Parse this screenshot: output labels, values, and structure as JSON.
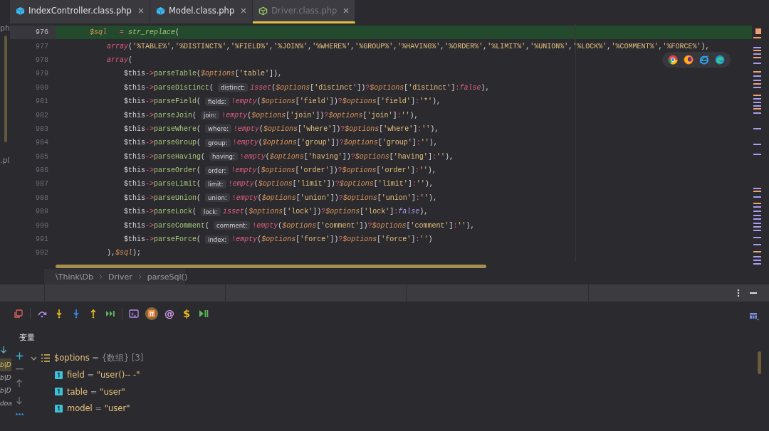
{
  "tabs": [
    {
      "label": "IndexController.class.php",
      "kind": "filled",
      "selected": false,
      "dimmed": false
    },
    {
      "label": "Model.class.php",
      "kind": "filled",
      "selected": false,
      "dimmed": false
    },
    {
      "label": "Driver.class.php",
      "kind": "outline",
      "selected": true,
      "dimmed": true
    }
  ],
  "project_fragments": [
    "ph",
    ".pl"
  ],
  "editor": {
    "lines": [
      {
        "number": "976",
        "current": true,
        "tokens": [
          {
            "kind": "var",
            "text": "$sql"
          },
          {
            "kind": "op",
            "text": "   = "
          },
          {
            "kind": "fnc",
            "text": "str_replace"
          },
          {
            "kind": "plain",
            "text": "("
          }
        ],
        "children": [
          {
            "number": "977",
            "current": false,
            "tokens": [
              {
                "kind": "kw",
                "text": "array"
              },
              {
                "kind": "plain",
                "text": "("
              },
              {
                "kind": "str",
                "text": "'%TABLE%'"
              },
              {
                "kind": "plain",
                "text": ","
              },
              {
                "kind": "str",
                "text": "'%DISTINCT%'"
              },
              {
                "kind": "plain",
                "text": ","
              },
              {
                "kind": "str",
                "text": "'%FIELD%'"
              },
              {
                "kind": "plain",
                "text": ","
              },
              {
                "kind": "str",
                "text": "'%JOIN%'"
              },
              {
                "kind": "plain",
                "text": ","
              },
              {
                "kind": "str",
                "text": "'%WHERE%'"
              },
              {
                "kind": "plain",
                "text": ","
              },
              {
                "kind": "str",
                "text": "'%GROUP%'"
              },
              {
                "kind": "plain",
                "text": ","
              },
              {
                "kind": "str",
                "text": "'%HAVING%'"
              },
              {
                "kind": "plain",
                "text": ","
              },
              {
                "kind": "str",
                "text": "'%ORDER%'"
              },
              {
                "kind": "plain",
                "text": ","
              },
              {
                "kind": "str",
                "text": "'%LIMIT%'"
              },
              {
                "kind": "plain",
                "text": ","
              },
              {
                "kind": "str",
                "text": "'%UNION%'"
              },
              {
                "kind": "plain",
                "text": ","
              },
              {
                "kind": "str",
                "text": "'%LOCK%'"
              },
              {
                "kind": "plain",
                "text": ","
              },
              {
                "kind": "str",
                "text": "'%COMMENT%'"
              },
              {
                "kind": "plain",
                "text": ","
              },
              {
                "kind": "str",
                "text": "'%FORCE%'"
              },
              {
                "kind": "plain",
                "text": "),"
              }
            ]
          },
          {
            "number": "978",
            "current": false,
            "tokens": [
              {
                "kind": "kw",
                "text": "array"
              },
              {
                "kind": "plain",
                "text": "("
              }
            ],
            "children": [
              {
                "number": "979",
                "current": false,
                "tokens": [
                  {
                    "kind": "plain",
                    "text": "$this"
                  },
                  {
                    "kind": "op",
                    "text": "->"
                  },
                  {
                    "kind": "fn",
                    "text": "parseTable"
                  },
                  {
                    "kind": "plain",
                    "text": "("
                  },
                  {
                    "kind": "var",
                    "text": "$options"
                  },
                  {
                    "kind": "plain",
                    "text": "["
                  },
                  {
                    "kind": "str",
                    "text": "'table'"
                  },
                  {
                    "kind": "plain",
                    "text": "]),"
                  }
                ]
              },
              {
                "number": "980",
                "current": false,
                "tokens": [
                  {
                    "kind": "plain",
                    "text": "$this"
                  },
                  {
                    "kind": "op",
                    "text": "->"
                  },
                  {
                    "kind": "fn",
                    "text": "parseDistinct"
                  },
                  {
                    "kind": "plain",
                    "text": "( "
                  },
                  {
                    "kind": "hint",
                    "text": "distinct:"
                  },
                  {
                    "kind": "kw",
                    "text": "isset"
                  },
                  {
                    "kind": "plain",
                    "text": "("
                  },
                  {
                    "kind": "var",
                    "text": "$options"
                  },
                  {
                    "kind": "plain",
                    "text": "["
                  },
                  {
                    "kind": "str",
                    "text": "'distinct'"
                  },
                  {
                    "kind": "plain",
                    "text": "])"
                  },
                  {
                    "kind": "op",
                    "text": "?"
                  },
                  {
                    "kind": "var",
                    "text": "$options"
                  },
                  {
                    "kind": "plain",
                    "text": "["
                  },
                  {
                    "kind": "str",
                    "text": "'distinct'"
                  },
                  {
                    "kind": "plain",
                    "text": "]"
                  },
                  {
                    "kind": "op",
                    "text": ":"
                  },
                  {
                    "kind": "kw",
                    "text": "false"
                  },
                  {
                    "kind": "plain",
                    "text": "),"
                  }
                ]
              },
              {
                "number": "981",
                "current": false,
                "tokens": [
                  {
                    "kind": "plain",
                    "text": "$this"
                  },
                  {
                    "kind": "op",
                    "text": "->"
                  },
                  {
                    "kind": "fn",
                    "text": "parseField"
                  },
                  {
                    "kind": "plain",
                    "text": "( "
                  },
                  {
                    "kind": "hint",
                    "text": "fields:"
                  },
                  {
                    "kind": "op",
                    "text": "!"
                  },
                  {
                    "kind": "kw",
                    "text": "empty"
                  },
                  {
                    "kind": "plain",
                    "text": "("
                  },
                  {
                    "kind": "var",
                    "text": "$options"
                  },
                  {
                    "kind": "plain",
                    "text": "["
                  },
                  {
                    "kind": "str",
                    "text": "'field'"
                  },
                  {
                    "kind": "plain",
                    "text": "])"
                  },
                  {
                    "kind": "op",
                    "text": "?"
                  },
                  {
                    "kind": "var",
                    "text": "$options"
                  },
                  {
                    "kind": "plain",
                    "text": "["
                  },
                  {
                    "kind": "str",
                    "text": "'field'"
                  },
                  {
                    "kind": "plain",
                    "text": "]"
                  },
                  {
                    "kind": "op",
                    "text": ":"
                  },
                  {
                    "kind": "str",
                    "text": "'*'"
                  },
                  {
                    "kind": "plain",
                    "text": "),"
                  }
                ]
              },
              {
                "number": "982",
                "current": false,
                "tokens": [
                  {
                    "kind": "plain",
                    "text": "$this"
                  },
                  {
                    "kind": "op",
                    "text": "->"
                  },
                  {
                    "kind": "fn",
                    "text": "parseJoin"
                  },
                  {
                    "kind": "plain",
                    "text": "( "
                  },
                  {
                    "kind": "hint",
                    "text": "join:"
                  },
                  {
                    "kind": "op",
                    "text": "!"
                  },
                  {
                    "kind": "kw",
                    "text": "empty"
                  },
                  {
                    "kind": "plain",
                    "text": "("
                  },
                  {
                    "kind": "var",
                    "text": "$options"
                  },
                  {
                    "kind": "plain",
                    "text": "["
                  },
                  {
                    "kind": "str",
                    "text": "'join'"
                  },
                  {
                    "kind": "plain",
                    "text": "])"
                  },
                  {
                    "kind": "op",
                    "text": "?"
                  },
                  {
                    "kind": "var",
                    "text": "$options"
                  },
                  {
                    "kind": "plain",
                    "text": "["
                  },
                  {
                    "kind": "str",
                    "text": "'join'"
                  },
                  {
                    "kind": "plain",
                    "text": "]"
                  },
                  {
                    "kind": "op",
                    "text": ":"
                  },
                  {
                    "kind": "str",
                    "text": "''"
                  },
                  {
                    "kind": "plain",
                    "text": "),"
                  }
                ]
              },
              {
                "number": "983",
                "current": false,
                "tokens": [
                  {
                    "kind": "plain",
                    "text": "$this"
                  },
                  {
                    "kind": "op",
                    "text": "->"
                  },
                  {
                    "kind": "fn",
                    "text": "parseWhere"
                  },
                  {
                    "kind": "plain",
                    "text": "( "
                  },
                  {
                    "kind": "hint",
                    "text": "where:"
                  },
                  {
                    "kind": "op",
                    "text": "!"
                  },
                  {
                    "kind": "kw",
                    "text": "empty"
                  },
                  {
                    "kind": "plain",
                    "text": "("
                  },
                  {
                    "kind": "var",
                    "text": "$options"
                  },
                  {
                    "kind": "plain",
                    "text": "["
                  },
                  {
                    "kind": "str",
                    "text": "'where'"
                  },
                  {
                    "kind": "plain",
                    "text": "])"
                  },
                  {
                    "kind": "op",
                    "text": "?"
                  },
                  {
                    "kind": "var",
                    "text": "$options"
                  },
                  {
                    "kind": "plain",
                    "text": "["
                  },
                  {
                    "kind": "str",
                    "text": "'where'"
                  },
                  {
                    "kind": "plain",
                    "text": "]"
                  },
                  {
                    "kind": "op",
                    "text": ":"
                  },
                  {
                    "kind": "str",
                    "text": "''"
                  },
                  {
                    "kind": "plain",
                    "text": "),"
                  }
                ]
              },
              {
                "number": "984",
                "current": false,
                "tokens": [
                  {
                    "kind": "plain",
                    "text": "$this"
                  },
                  {
                    "kind": "op",
                    "text": "->"
                  },
                  {
                    "kind": "fn",
                    "text": "parseGroup"
                  },
                  {
                    "kind": "plain",
                    "text": "( "
                  },
                  {
                    "kind": "hint",
                    "text": "group:"
                  },
                  {
                    "kind": "op",
                    "text": "!"
                  },
                  {
                    "kind": "kw",
                    "text": "empty"
                  },
                  {
                    "kind": "plain",
                    "text": "("
                  },
                  {
                    "kind": "var",
                    "text": "$options"
                  },
                  {
                    "kind": "plain",
                    "text": "["
                  },
                  {
                    "kind": "str",
                    "text": "'group'"
                  },
                  {
                    "kind": "plain",
                    "text": "])"
                  },
                  {
                    "kind": "op",
                    "text": "?"
                  },
                  {
                    "kind": "var",
                    "text": "$options"
                  },
                  {
                    "kind": "plain",
                    "text": "["
                  },
                  {
                    "kind": "str",
                    "text": "'group'"
                  },
                  {
                    "kind": "plain",
                    "text": "]"
                  },
                  {
                    "kind": "op",
                    "text": ":"
                  },
                  {
                    "kind": "str",
                    "text": "''"
                  },
                  {
                    "kind": "plain",
                    "text": "),"
                  }
                ]
              },
              {
                "number": "985",
                "current": false,
                "tokens": [
                  {
                    "kind": "plain",
                    "text": "$this"
                  },
                  {
                    "kind": "op",
                    "text": "->"
                  },
                  {
                    "kind": "fn",
                    "text": "parseHaving"
                  },
                  {
                    "kind": "plain",
                    "text": "( "
                  },
                  {
                    "kind": "hint",
                    "text": "having:"
                  },
                  {
                    "kind": "op",
                    "text": "!"
                  },
                  {
                    "kind": "kw",
                    "text": "empty"
                  },
                  {
                    "kind": "plain",
                    "text": "("
                  },
                  {
                    "kind": "var",
                    "text": "$options"
                  },
                  {
                    "kind": "plain",
                    "text": "["
                  },
                  {
                    "kind": "str",
                    "text": "'having'"
                  },
                  {
                    "kind": "plain",
                    "text": "])"
                  },
                  {
                    "kind": "op",
                    "text": "?"
                  },
                  {
                    "kind": "var",
                    "text": "$options"
                  },
                  {
                    "kind": "plain",
                    "text": "["
                  },
                  {
                    "kind": "str",
                    "text": "'having'"
                  },
                  {
                    "kind": "plain",
                    "text": "]"
                  },
                  {
                    "kind": "op",
                    "text": ":"
                  },
                  {
                    "kind": "str",
                    "text": "''"
                  },
                  {
                    "kind": "plain",
                    "text": "),"
                  }
                ]
              },
              {
                "number": "986",
                "current": false,
                "tokens": [
                  {
                    "kind": "plain",
                    "text": "$this"
                  },
                  {
                    "kind": "op",
                    "text": "->"
                  },
                  {
                    "kind": "fn",
                    "text": "parseOrder"
                  },
                  {
                    "kind": "plain",
                    "text": "( "
                  },
                  {
                    "kind": "hint",
                    "text": "order:"
                  },
                  {
                    "kind": "op",
                    "text": "!"
                  },
                  {
                    "kind": "kw",
                    "text": "empty"
                  },
                  {
                    "kind": "plain",
                    "text": "("
                  },
                  {
                    "kind": "var",
                    "text": "$options"
                  },
                  {
                    "kind": "plain",
                    "text": "["
                  },
                  {
                    "kind": "str",
                    "text": "'order'"
                  },
                  {
                    "kind": "plain",
                    "text": "])"
                  },
                  {
                    "kind": "op",
                    "text": "?"
                  },
                  {
                    "kind": "var",
                    "text": "$options"
                  },
                  {
                    "kind": "plain",
                    "text": "["
                  },
                  {
                    "kind": "str",
                    "text": "'order'"
                  },
                  {
                    "kind": "plain",
                    "text": "]"
                  },
                  {
                    "kind": "op",
                    "text": ":"
                  },
                  {
                    "kind": "str",
                    "text": "''"
                  },
                  {
                    "kind": "plain",
                    "text": "),"
                  }
                ]
              },
              {
                "number": "987",
                "current": false,
                "tokens": [
                  {
                    "kind": "plain",
                    "text": "$this"
                  },
                  {
                    "kind": "op",
                    "text": "->"
                  },
                  {
                    "kind": "fn",
                    "text": "parseLimit"
                  },
                  {
                    "kind": "plain",
                    "text": "( "
                  },
                  {
                    "kind": "hint",
                    "text": "limit:"
                  },
                  {
                    "kind": "op",
                    "text": "!"
                  },
                  {
                    "kind": "kw",
                    "text": "empty"
                  },
                  {
                    "kind": "plain",
                    "text": "("
                  },
                  {
                    "kind": "var",
                    "text": "$options"
                  },
                  {
                    "kind": "plain",
                    "text": "["
                  },
                  {
                    "kind": "str",
                    "text": "'limit'"
                  },
                  {
                    "kind": "plain",
                    "text": "])"
                  },
                  {
                    "kind": "op",
                    "text": "?"
                  },
                  {
                    "kind": "var",
                    "text": "$options"
                  },
                  {
                    "kind": "plain",
                    "text": "["
                  },
                  {
                    "kind": "str",
                    "text": "'limit'"
                  },
                  {
                    "kind": "plain",
                    "text": "]"
                  },
                  {
                    "kind": "op",
                    "text": ":"
                  },
                  {
                    "kind": "str",
                    "text": "''"
                  },
                  {
                    "kind": "plain",
                    "text": "),"
                  }
                ]
              },
              {
                "number": "988",
                "current": false,
                "tokens": [
                  {
                    "kind": "plain",
                    "text": "$this"
                  },
                  {
                    "kind": "op",
                    "text": "->"
                  },
                  {
                    "kind": "fn",
                    "text": "parseUnion"
                  },
                  {
                    "kind": "plain",
                    "text": "( "
                  },
                  {
                    "kind": "hint",
                    "text": "union:"
                  },
                  {
                    "kind": "op",
                    "text": "!"
                  },
                  {
                    "kind": "kw",
                    "text": "empty"
                  },
                  {
                    "kind": "plain",
                    "text": "("
                  },
                  {
                    "kind": "var",
                    "text": "$options"
                  },
                  {
                    "kind": "plain",
                    "text": "["
                  },
                  {
                    "kind": "str",
                    "text": "'union'"
                  },
                  {
                    "kind": "plain",
                    "text": "])"
                  },
                  {
                    "kind": "op",
                    "text": "?"
                  },
                  {
                    "kind": "var",
                    "text": "$options"
                  },
                  {
                    "kind": "plain",
                    "text": "["
                  },
                  {
                    "kind": "str",
                    "text": "'union'"
                  },
                  {
                    "kind": "plain",
                    "text": "]"
                  },
                  {
                    "kind": "op",
                    "text": ":"
                  },
                  {
                    "kind": "str",
                    "text": "''"
                  },
                  {
                    "kind": "plain",
                    "text": "),"
                  }
                ]
              },
              {
                "number": "989",
                "current": false,
                "tokens": [
                  {
                    "kind": "plain",
                    "text": "$this"
                  },
                  {
                    "kind": "op",
                    "text": "->"
                  },
                  {
                    "kind": "fn",
                    "text": "parseLock"
                  },
                  {
                    "kind": "plain",
                    "text": "( "
                  },
                  {
                    "kind": "hint",
                    "text": "lock:"
                  },
                  {
                    "kind": "kw",
                    "text": "isset"
                  },
                  {
                    "kind": "plain",
                    "text": "("
                  },
                  {
                    "kind": "var",
                    "text": "$options"
                  },
                  {
                    "kind": "plain",
                    "text": "["
                  },
                  {
                    "kind": "str",
                    "text": "'lock'"
                  },
                  {
                    "kind": "plain",
                    "text": "])"
                  },
                  {
                    "kind": "op",
                    "text": "?"
                  },
                  {
                    "kind": "var",
                    "text": "$options"
                  },
                  {
                    "kind": "plain",
                    "text": "["
                  },
                  {
                    "kind": "str",
                    "text": "'lock'"
                  },
                  {
                    "kind": "plain",
                    "text": "]"
                  },
                  {
                    "kind": "op",
                    "text": ":"
                  },
                  {
                    "kind": "bool",
                    "text": "false"
                  },
                  {
                    "kind": "plain",
                    "text": "),"
                  }
                ]
              },
              {
                "number": "990",
                "current": false,
                "tokens": [
                  {
                    "kind": "plain",
                    "text": "$this"
                  },
                  {
                    "kind": "op",
                    "text": "->"
                  },
                  {
                    "kind": "fn",
                    "text": "parseComment"
                  },
                  {
                    "kind": "plain",
                    "text": "( "
                  },
                  {
                    "kind": "hint",
                    "text": "comment:"
                  },
                  {
                    "kind": "op",
                    "text": "!"
                  },
                  {
                    "kind": "kw",
                    "text": "empty"
                  },
                  {
                    "kind": "plain",
                    "text": "("
                  },
                  {
                    "kind": "var",
                    "text": "$options"
                  },
                  {
                    "kind": "plain",
                    "text": "["
                  },
                  {
                    "kind": "str",
                    "text": "'comment'"
                  },
                  {
                    "kind": "plain",
                    "text": "])"
                  },
                  {
                    "kind": "op",
                    "text": "?"
                  },
                  {
                    "kind": "var",
                    "text": "$options"
                  },
                  {
                    "kind": "plain",
                    "text": "["
                  },
                  {
                    "kind": "str",
                    "text": "'comment'"
                  },
                  {
                    "kind": "plain",
                    "text": "]"
                  },
                  {
                    "kind": "op",
                    "text": ":"
                  },
                  {
                    "kind": "str",
                    "text": "''"
                  },
                  {
                    "kind": "plain",
                    "text": "),"
                  }
                ]
              },
              {
                "number": "991",
                "current": false,
                "tokens": [
                  {
                    "kind": "plain",
                    "text": "$this"
                  },
                  {
                    "kind": "op",
                    "text": "->"
                  },
                  {
                    "kind": "fn",
                    "text": "parseForce"
                  },
                  {
                    "kind": "plain",
                    "text": "( "
                  },
                  {
                    "kind": "hint",
                    "text": "index:"
                  },
                  {
                    "kind": "op",
                    "text": "!"
                  },
                  {
                    "kind": "kw",
                    "text": "empty"
                  },
                  {
                    "kind": "plain",
                    "text": "("
                  },
                  {
                    "kind": "var",
                    "text": "$options"
                  },
                  {
                    "kind": "plain",
                    "text": "["
                  },
                  {
                    "kind": "str",
                    "text": "'force'"
                  },
                  {
                    "kind": "plain",
                    "text": "])"
                  },
                  {
                    "kind": "op",
                    "text": "?"
                  },
                  {
                    "kind": "var",
                    "text": "$options"
                  },
                  {
                    "kind": "plain",
                    "text": "["
                  },
                  {
                    "kind": "str",
                    "text": "'force'"
                  },
                  {
                    "kind": "plain",
                    "text": "]"
                  },
                  {
                    "kind": "op",
                    "text": ":"
                  },
                  {
                    "kind": "str",
                    "text": "''"
                  },
                  {
                    "kind": "plain",
                    "text": ")"
                  }
                ]
              }
            ]
          },
          {
            "number": "992",
            "current": false,
            "tokens": [
              {
                "kind": "plain",
                "text": "),"
              },
              {
                "kind": "var",
                "text": "$sql"
              },
              {
                "kind": "plain",
                "text": ");"
              }
            ]
          }
        ]
      }
    ]
  },
  "breadcrumbs": [
    "\\Think\\Db",
    "Driver",
    "parseSql()"
  ],
  "debug": {
    "toolbar": [
      {
        "kind": "stop",
        "on": false
      },
      {
        "kind": "step-over",
        "on": false
      },
      {
        "kind": "step-into",
        "on": false
      },
      {
        "kind": "force-step-into",
        "on": false
      },
      {
        "kind": "step-out",
        "on": false
      },
      {
        "kind": "run-to-cursor",
        "on": false
      },
      {
        "kind": "console",
        "on": false
      },
      {
        "kind": "pi",
        "on": true
      },
      {
        "kind": "glyph",
        "text": "@",
        "on": false
      },
      {
        "kind": "glyph",
        "text": "$",
        "on": false
      },
      {
        "kind": "resume",
        "on": false
      }
    ],
    "section_title": "变量",
    "frames": [
      {
        "label": "b|D",
        "selected": true
      },
      {
        "label": "b|D",
        "selected": false
      },
      {
        "label": "b|D",
        "selected": false
      },
      {
        "label": "doa",
        "selected": false
      }
    ],
    "variable": {
      "name": "$options",
      "operator": "=",
      "type": "{数组}",
      "count": "[3]",
      "expanded": true,
      "children": [
        {
          "name": "field",
          "operator": "=",
          "value": "\"user()-- -\""
        },
        {
          "name": "table",
          "operator": "=",
          "value": "\"user\""
        },
        {
          "name": "model",
          "operator": "=",
          "value": "\"user\""
        }
      ]
    }
  }
}
